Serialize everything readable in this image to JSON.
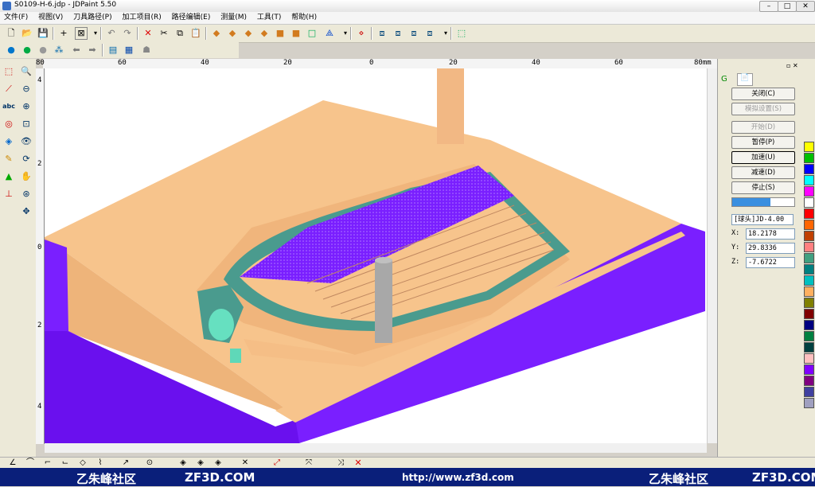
{
  "window": {
    "title": "S0109-H-6.jdp - JDPaint 5.50",
    "min": "–",
    "max": "□",
    "close": "✕"
  },
  "menu": [
    "文件(F)",
    "视图(V)",
    "刀具路径(P)",
    "加工项目(R)",
    "路径编辑(E)",
    "测量(M)",
    "工具(T)",
    "帮助(H)"
  ],
  "ruler_top": [
    "80",
    "60",
    "40",
    "20",
    "0",
    "20",
    "40",
    "60",
    "80mm"
  ],
  "ruler_left": [
    "4",
    "2",
    "0",
    "2",
    "4"
  ],
  "panel": {
    "tabs": [
      "G",
      "📄"
    ],
    "buttons": [
      {
        "label": "关闭(C)",
        "enabled": true
      },
      {
        "label": "模拟设置(S)",
        "enabled": false
      },
      {
        "label": "开始(D)",
        "enabled": false
      },
      {
        "label": "暂停(P)",
        "enabled": true
      },
      {
        "label": "加速(U)",
        "enabled": true
      },
      {
        "label": "减速(D)",
        "enabled": true
      },
      {
        "label": "停止(S)",
        "enabled": true
      }
    ],
    "progress": 0.62,
    "tool": "[球头]JD-4.00",
    "coords": [
      {
        "axis": "X:",
        "value": "18.2178"
      },
      {
        "axis": "Y:",
        "value": "29.8336"
      },
      {
        "axis": "Z:",
        "value": "-7.6722"
      }
    ]
  },
  "palette": [
    "#ffff00",
    "#00c000",
    "#0000ff",
    "#00ffff",
    "#ff00ff",
    "#ffffff",
    "#ff0000",
    "#ff6600",
    "#c04000",
    "#ff8080",
    "#40a080",
    "#008080",
    "#00c0c0",
    "#ffb060",
    "#808000",
    "#800000",
    "#000080",
    "#008040",
    "#004040",
    "#ffc0c0",
    "#8000ff",
    "#800080",
    "#4040a0",
    "#a0a0c0"
  ],
  "watermark": {
    "left_logo": "⼄朱峰社区",
    "left_site": "ZF3D.COM",
    "url": "http://www.zf3d.com",
    "right_logo": "⼄朱峰社区",
    "right_site": "ZF3D.COM"
  },
  "colors": {
    "stock": "#f7c48c",
    "path": "#7a1fff",
    "fixture": "#4a9b8e",
    "tool": "#a8a8a8"
  }
}
